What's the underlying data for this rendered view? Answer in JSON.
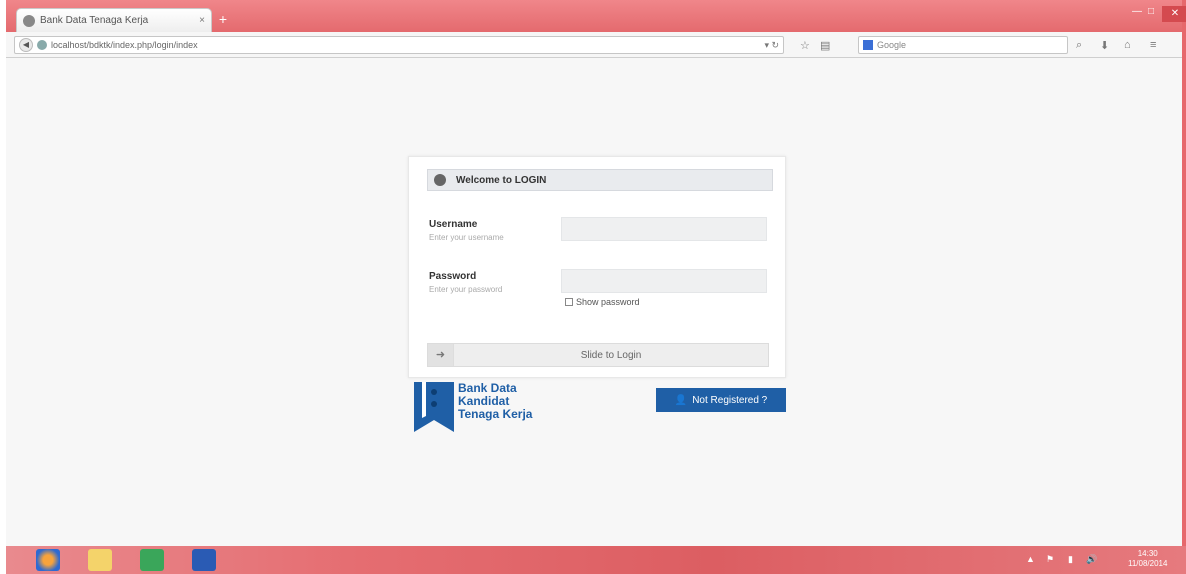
{
  "browser": {
    "tab_title": "Bank Data Tenaga Kerja",
    "tab_close": "×",
    "new_tab": "+",
    "url": "localhost/bdktk/index.php/login/index",
    "search_placeholder": "Google",
    "window_controls": {
      "minimize": "—",
      "maximize": "□",
      "close": "✕"
    }
  },
  "login": {
    "header": "Welcome to LOGIN",
    "username_label": "Username",
    "username_hint": "Enter your username",
    "password_label": "Password",
    "password_hint": "Enter your password",
    "show_password": "Show password",
    "submit_label": "Slide to Login"
  },
  "logo": {
    "line1": "Bank Data",
    "line2": "Kandidat",
    "line3": "Tenaga Kerja"
  },
  "register": {
    "label": "Not Registered ?"
  },
  "taskbar": {
    "clock_time": "14:30",
    "clock_date": "11/08/2014"
  },
  "colors": {
    "accent": "#1f5fa6",
    "frame": "#e6686c"
  }
}
